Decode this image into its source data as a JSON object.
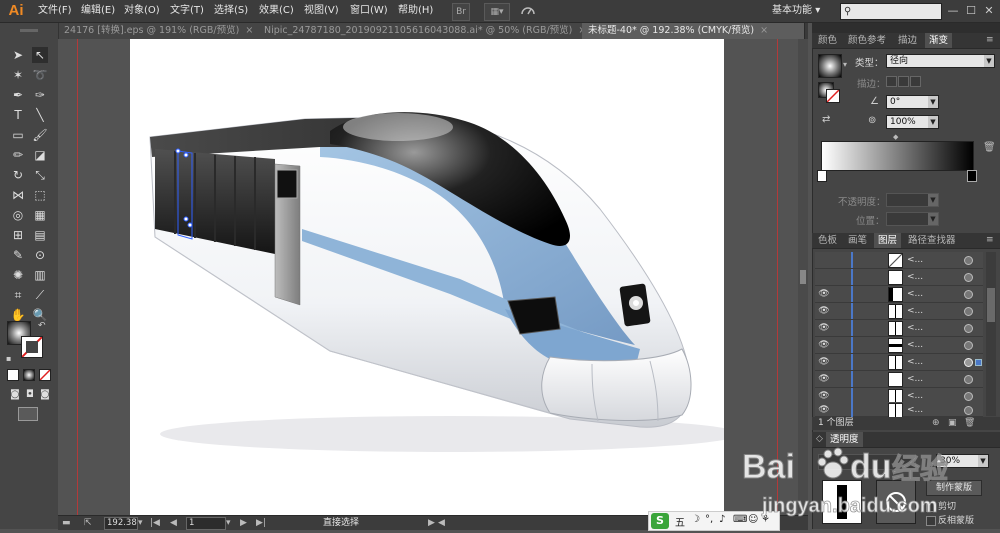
{
  "app": {
    "logo": "Ai",
    "workspace": "基本功能",
    "workspace_arrow": "▾"
  },
  "menu": [
    "文件(F)",
    "编辑(E)",
    "对象(O)",
    "文字(T)",
    "选择(S)",
    "效果(C)",
    "视图(V)",
    "窗口(W)",
    "帮助(H)"
  ],
  "menu_icons": {
    "bridge": "Br",
    "arrange": "▦▾"
  },
  "window_buttons": {
    "minimize": "—",
    "maximize": "☐",
    "close": "✕"
  },
  "tabs": [
    {
      "label": "24176 [转换].eps @ 191% (RGB/预览)",
      "close": "×",
      "active": false
    },
    {
      "label": "Nipic_24787180_20190921105616043088.ai* @ 50% (RGB/预览)",
      "close": "×",
      "active": false
    },
    {
      "label": "未标题-40* @ 192.38% (CMYK/预览)",
      "close": "×",
      "active": true
    }
  ],
  "status": {
    "zoom": "192.38",
    "page": "1",
    "tool": "直接选择",
    "zoom_arrow": "▾",
    "nav_first": "|◀",
    "nav_prev": "◀",
    "nav_next": "▶",
    "nav_last": "▶|",
    "play": "▶"
  },
  "gradient_panel": {
    "tabs": [
      "颜色",
      "颜色参考",
      "描边",
      "渐变"
    ],
    "type_label": "类型：",
    "type_value": "径向",
    "stroke_label": "描边：",
    "angle_value": "0°",
    "ratio_value": "100%",
    "opacity_label": "不透明度：",
    "position_label": "位置："
  },
  "layers_panel": {
    "tabs": [
      "色板",
      "画笔",
      "图层",
      "路径查找器"
    ],
    "rows": [
      {
        "name": "<...",
        "visible": false
      },
      {
        "name": "<...",
        "visible": false
      },
      {
        "name": "<...",
        "visible": true
      },
      {
        "name": "<...",
        "visible": true
      },
      {
        "name": "<...",
        "visible": true
      },
      {
        "name": "<...",
        "visible": true
      },
      {
        "name": "<...",
        "visible": true
      },
      {
        "name": "<...",
        "visible": true
      },
      {
        "name": "<...",
        "visible": true
      },
      {
        "name": "<...",
        "visible": true
      }
    ],
    "footer": "1 个图层"
  },
  "bottom_panel": {
    "tab": "透明度",
    "opacity_value": "30%",
    "make_mask": "制作蒙版",
    "clip": "剪切",
    "invert_mask": "反相蒙版"
  },
  "ime": {
    "chars": [
      "五",
      "☽",
      "°,",
      "🎤",
      "⌨",
      "👤",
      "👕",
      "✿"
    ]
  },
  "watermark": {
    "brand_left": "Bai",
    "brand_right": "du",
    "brand_cn": "经验",
    "url": "jingyan.baidu.com"
  },
  "colors": {
    "accent_logo": "#f08a24",
    "train_blue": "#8fb4d8",
    "train_window": "#111111"
  }
}
